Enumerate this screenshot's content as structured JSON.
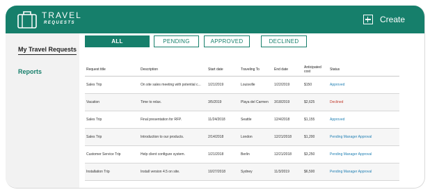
{
  "header": {
    "logo_title": "TRAVEL",
    "logo_subtitle": "REQUESTS",
    "create_label": "Create",
    "background": "#167f6b"
  },
  "sidebar": {
    "items": [
      {
        "label": "My Travel Requests",
        "active": true
      },
      {
        "label": "Reports",
        "active": false
      }
    ]
  },
  "filters": [
    {
      "label": "ALL",
      "active": true
    },
    {
      "label": "PENDING",
      "active": false
    },
    {
      "label": "APPROVED",
      "active": false
    },
    {
      "label": "DECLINED",
      "active": false
    }
  ],
  "table": {
    "columns": [
      "Request title",
      "Description",
      "Start date",
      "Traveling To",
      "End date",
      "Anticipated cost",
      "Status"
    ],
    "rows": [
      {
        "title": "Sales Trip",
        "description": "On site sales meeting with potential c...",
        "start": "1/21/2019",
        "to": "Louisville",
        "end": "1/22/2019",
        "cost": "$150",
        "status": "Approved"
      },
      {
        "title": "Vacation",
        "description": "Time to relax.",
        "start": "3/5/2019",
        "to": "Playa del Carmen",
        "end": "3/18/2019",
        "cost": "$2,625",
        "status": "Declined"
      },
      {
        "title": "Sales Trip",
        "description": "Final presentation for RFP.",
        "start": "11/24/2018",
        "to": "Seattle",
        "end": "12/4/2018",
        "cost": "$1,155",
        "status": "Approved"
      },
      {
        "title": "Sales Trip",
        "description": "Introduction to our products.",
        "start": "2/14/2018",
        "to": "London",
        "end": "12/21/2018",
        "cost": "$1,200",
        "status": "Pending Manager Approval"
      },
      {
        "title": "Customer Service Trip",
        "description": "Help client configure system.",
        "start": "1/21/2018",
        "to": "Berlin",
        "end": "12/21/2018",
        "cost": "$3,250",
        "status": "Pending Manager Approval"
      },
      {
        "title": "Installation Trip",
        "description": "Install version 4.5 on site.",
        "start": "10/27/2018",
        "to": "Sydney",
        "end": "11/3/2019",
        "cost": "$6,500",
        "status": "Pending Manager Approval"
      }
    ]
  }
}
